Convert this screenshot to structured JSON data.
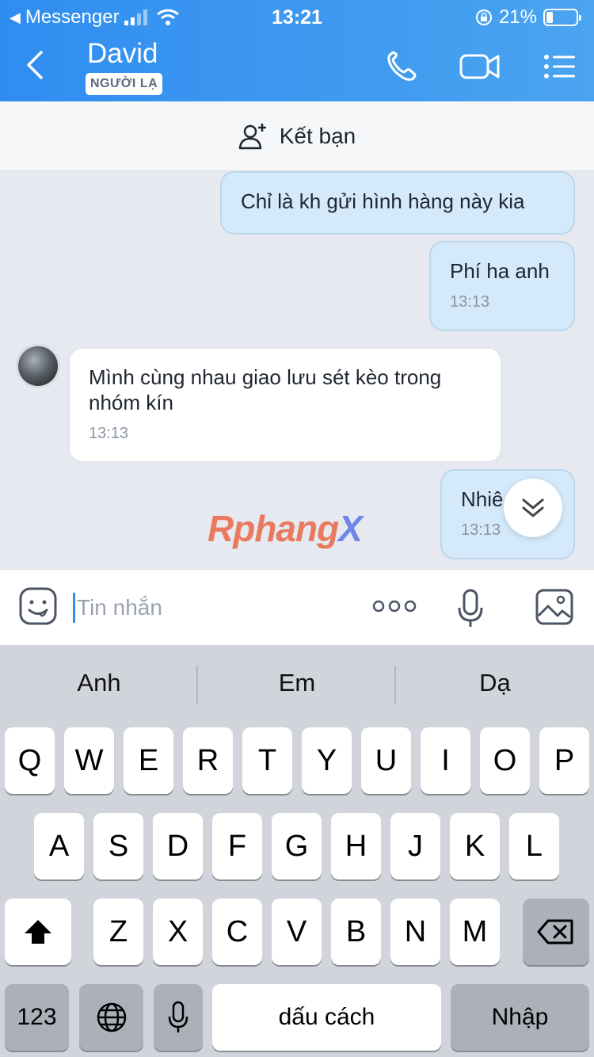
{
  "status_bar": {
    "back_app": "Messenger",
    "time": "13:21",
    "battery": "21%"
  },
  "header": {
    "contact_name": "David",
    "badge": "NGƯỜI LẠ"
  },
  "friend_bar": {
    "label": "Kết bạn"
  },
  "messages": [
    {
      "side": "mine",
      "text": "Chỉ là kh gửi hình hàng này kia",
      "time": ""
    },
    {
      "side": "mine",
      "text": "Phí ha anh",
      "time": "13:13"
    },
    {
      "side": "theirs",
      "text": "Mình cùng nhau giao lưu sét kèo trong nhóm kín",
      "time": "13:13"
    },
    {
      "side": "mine",
      "text": "Nhiê",
      "time": "13:13"
    }
  ],
  "watermark": {
    "part1": "Rphang",
    "part2": "X"
  },
  "composer": {
    "placeholder": "Tin nhắn"
  },
  "keyboard": {
    "suggestions": [
      "Anh",
      "Em",
      "Dạ"
    ],
    "row1": [
      "Q",
      "W",
      "E",
      "R",
      "T",
      "Y",
      "U",
      "I",
      "O",
      "P"
    ],
    "row2": [
      "A",
      "S",
      "D",
      "F",
      "G",
      "H",
      "J",
      "K",
      "L"
    ],
    "row3": [
      "Z",
      "X",
      "C",
      "V",
      "B",
      "N",
      "M"
    ],
    "numbers_key": "123",
    "space_key": "dấu cách",
    "return_key": "Nhập"
  },
  "icons": {
    "back": "chevron-left-icon",
    "call": "phone-icon",
    "video": "video-camera-icon",
    "menu": "list-icon",
    "add_friend": "user-plus-icon",
    "sticker": "emoji-icon",
    "more": "ellipsis-icon",
    "mic": "microphone-icon",
    "image": "image-icon",
    "scroll": "chevrons-down-icon",
    "shift": "shift-icon",
    "delete": "backspace-icon",
    "globe": "globe-icon"
  },
  "colors": {
    "header": "#2f8df0",
    "my_bubble": "#d4eafb",
    "their_bubble": "#ffffff",
    "accent": "#2f8df0"
  }
}
